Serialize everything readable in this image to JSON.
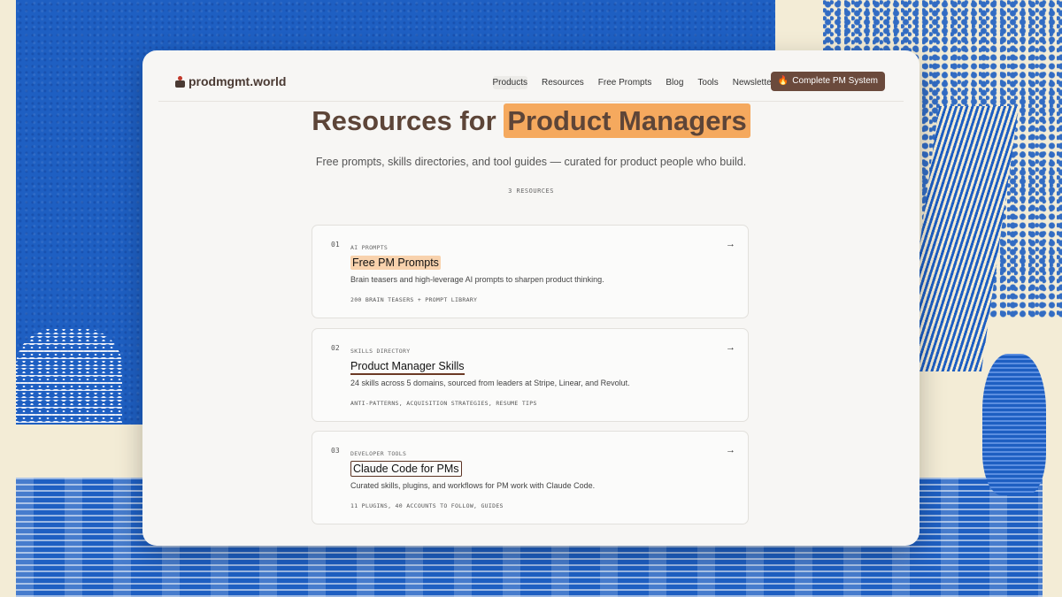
{
  "brand": {
    "name": "prodmgmt.world"
  },
  "nav": {
    "links": [
      "Products",
      "Resources",
      "Free Prompts",
      "Blog",
      "Tools",
      "Newsletter"
    ],
    "active": "Products",
    "cta_label": "Complete PM System"
  },
  "hero": {
    "title_prefix": "Resources for",
    "title_highlight": "Product Managers",
    "subtitle": "Free prompts, skills directories, and tool guides — curated for product people who build.",
    "count": "3 RESOURCES"
  },
  "resources": [
    {
      "num": "01",
      "category": "AI PROMPTS",
      "title": "Free PM Prompts",
      "description": "Brain teasers and high-leverage AI prompts to sharpen product thinking.",
      "meta": "200 BRAIN TEASERS + PROMPT LIBRARY"
    },
    {
      "num": "02",
      "category": "SKILLS DIRECTORY",
      "title": "Product Manager Skills",
      "description": "24 skills across 5 domains, sourced from leaders at Stripe, Linear, and Revolut.",
      "meta": "ANTI-PATTERNS, ACQUISITION STRATEGIES, RESUME TIPS"
    },
    {
      "num": "03",
      "category": "DEVELOPER TOOLS",
      "title": "Claude Code for PMs",
      "description": "Curated skills, plugins, and workflows for PM work with Claude Code.",
      "meta": "11 PLUGINS, 40 ACCOUNTS TO FOLLOW, GUIDES"
    }
  ],
  "icons": {
    "brand": "logo-icon",
    "cta": "flame-icon",
    "card_link": "arrow-right-icon"
  },
  "colors": {
    "accent": "#6b4a3c",
    "highlight": "#f5a95e",
    "background_blue": "#1e5fc2"
  }
}
